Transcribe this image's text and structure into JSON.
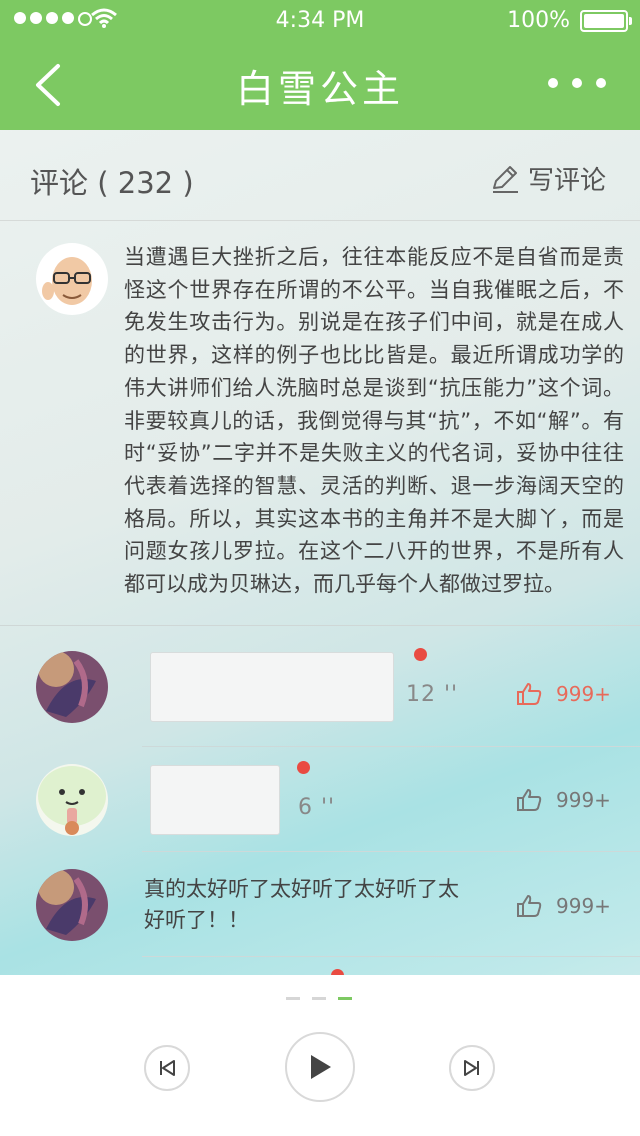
{
  "status_bar": {
    "time": "4:34 PM",
    "battery": "100%"
  },
  "header": {
    "title": "白雪公主"
  },
  "comments": {
    "count_label": "评论 ( 232 )",
    "write_label": "写评论"
  },
  "review": {
    "text": "当遭遇巨大挫折之后，往往本能反应不是自省而是责怪这个世界存在所谓的不公平。当自我催眠之后，不免发生攻击行为。别说是在孩子们中间，就是在成人的世界，这样的例子也比比皆是。最近所谓成功学的伟大讲师们给人洗脑时总是谈到“抗压能力”这个词。非要较真儿的话，我倒觉得与其“抗”，不如“解”。有时“妥协”二字并不是失败主义的代名词，妥协中往往代表着选择的智慧、灵活的判断、退一步海阔天空的格局。所以，其实这本书的主角并不是大脚丫，而是问题女孩儿罗拉。在这个二八开的世界，不是所有人都可以成为贝琳达，而几乎每个人都做过罗拉。"
  },
  "comment_list": [
    {
      "type": "voice",
      "duration": "12 ''",
      "likes": "999+",
      "liked": true
    },
    {
      "type": "voice",
      "duration": "6 ''",
      "likes": "999+",
      "liked": false
    },
    {
      "type": "text",
      "text": "真的太好听了太好听了太好听了太好听了！！",
      "likes": "999+",
      "liked": false
    }
  ],
  "colors": {
    "accent": "#7dc962",
    "unread": "#e94b42",
    "liked": "#e86a5a"
  },
  "player": {
    "page_count": 3,
    "active_page": 3
  }
}
